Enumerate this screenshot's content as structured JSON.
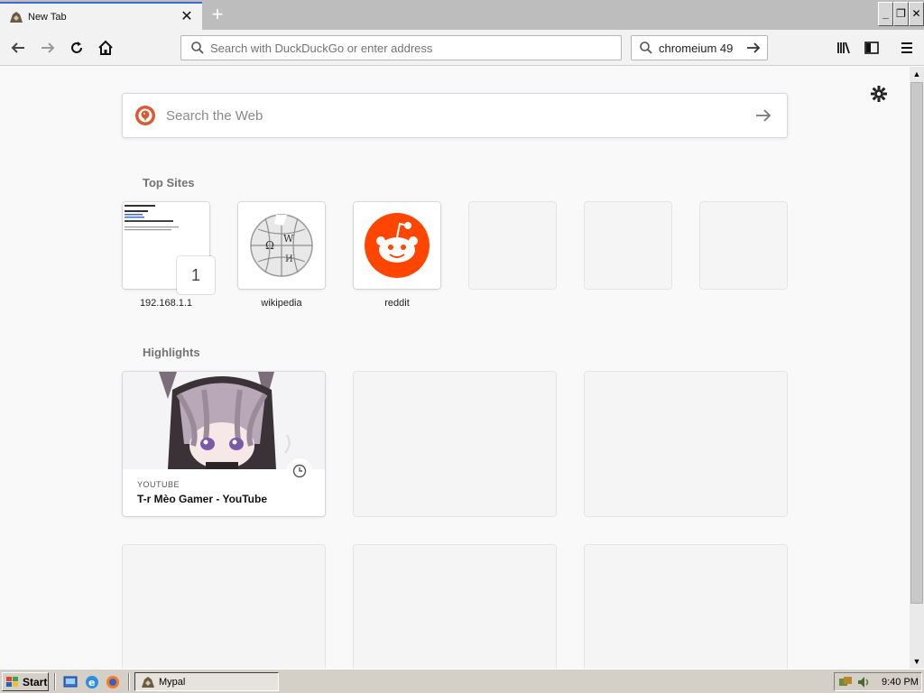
{
  "window": {
    "tab_title": "New Tab",
    "new_tab_symbol": "+",
    "min_symbol": "_",
    "restore_symbol": "❐",
    "close_symbol": "✕"
  },
  "toolbar": {
    "url_placeholder": "Search with DuckDuckGo or enter address",
    "search_value": "chromeium 49"
  },
  "newtab": {
    "web_search_placeholder": "Search the Web",
    "top_sites_heading": "Top Sites",
    "top_sites": [
      {
        "label": "192.168.1.1",
        "type": "screenshot"
      },
      {
        "label": "wikipedia",
        "type": "wikipedia"
      },
      {
        "label": "reddit",
        "type": "reddit"
      },
      {
        "label": "",
        "type": "empty"
      },
      {
        "label": "",
        "type": "empty"
      },
      {
        "label": "",
        "type": "empty"
      }
    ],
    "pin_badge": "1",
    "highlights_heading": "Highlights",
    "highlight_card": {
      "source": "YOUTUBE",
      "title": "T-r Mèo Gamer - YouTube"
    }
  },
  "taskbar": {
    "start_label": "Start",
    "task_label": "Mypal",
    "clock": "9:40 PM"
  },
  "colors": {
    "reddit": "#ff4500",
    "accent_blue": "#3a6bd8",
    "ddg_orange": "#de5833"
  }
}
